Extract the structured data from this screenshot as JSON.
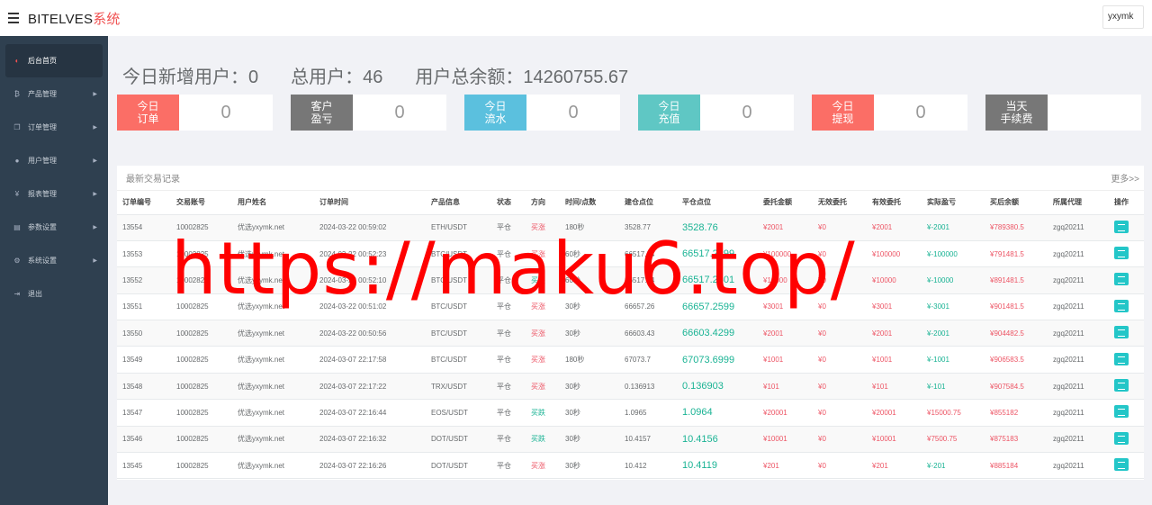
{
  "topbar": {
    "brand_main": "BITELVES",
    "brand_accent": "系统",
    "user": "yxymk"
  },
  "sidebar": {
    "items": [
      {
        "label": "后台首页",
        "icon": "dashboard-icon",
        "active": true
      },
      {
        "label": "产品管理",
        "icon": "bitcoin-icon"
      },
      {
        "label": "订单管理",
        "icon": "copy-icon"
      },
      {
        "label": "用户管理",
        "icon": "user-icon"
      },
      {
        "label": "报表管理",
        "icon": "yen-icon"
      },
      {
        "label": "参数设置",
        "icon": "files-icon"
      },
      {
        "label": "系统设置",
        "icon": "cogs-icon"
      },
      {
        "label": "退出",
        "icon": "logout-icon"
      }
    ]
  },
  "summary": {
    "new_users": "今日新增用户：0",
    "total_users": "总用户：46",
    "total_balance": "用户总余额：14260755.67"
  },
  "cards": [
    {
      "label": "今日\n订单",
      "value": "0",
      "color": "#fb6e66"
    },
    {
      "label": "客户\n盈亏",
      "value": "0",
      "color": "#777777"
    },
    {
      "label": "今日\n流水",
      "value": "0",
      "color": "#5bc0de"
    },
    {
      "label": "今日\n充值",
      "value": "0",
      "color": "#5fc7c4"
    },
    {
      "label": "今日\n提现",
      "value": "0",
      "color": "#fb6e66"
    },
    {
      "label": "当天\n手续费",
      "value": "",
      "color": "#777777"
    }
  ],
  "table": {
    "title": "最新交易记录",
    "more": "更多>>",
    "headers": [
      "订单编号",
      "交易账号",
      "用户姓名",
      "订单时间",
      "产品信息",
      "状态",
      "方向",
      "时间/点数",
      "建仓点位",
      "平仓点位",
      "委托金额",
      "无效委托",
      "有效委托",
      "实际盈亏",
      "买后余额",
      "所属代理",
      "操作"
    ],
    "rows": [
      [
        "13554",
        "10002825",
        "优选yxymk.net",
        "2024-03-22 00:59:02",
        "ETH/USDT",
        "平仓",
        "买涨",
        "180秒",
        "3528.77",
        "3528.76",
        "¥2001",
        "¥0",
        "¥2001",
        "¥-2001",
        "¥789380.5",
        "zgq20211"
      ],
      [
        "13553",
        "10002825",
        "优选yxymk.net",
        "2024-03-22 00:52:23",
        "BTC/USDT",
        "平仓",
        "买涨",
        "60秒",
        "66517.24",
        "66517.2399",
        "¥100000",
        "¥0",
        "¥100000",
        "¥-100000",
        "¥791481.5",
        "zgq20211"
      ],
      [
        "13552",
        "10002825",
        "优选yxymk.net",
        "2024-03-22 00:52:10",
        "BTC/USDT",
        "平仓",
        "买跌",
        "60秒",
        "66517.24",
        "66517.2401",
        "¥10000",
        "¥0",
        "¥10000",
        "¥-10000",
        "¥891481.5",
        "zgq20211"
      ],
      [
        "13551",
        "10002825",
        "优选yxymk.net",
        "2024-03-22 00:51:02",
        "BTC/USDT",
        "平仓",
        "买涨",
        "30秒",
        "66657.26",
        "66657.2599",
        "¥3001",
        "¥0",
        "¥3001",
        "¥-3001",
        "¥901481.5",
        "zgq20211"
      ],
      [
        "13550",
        "10002825",
        "优选yxymk.net",
        "2024-03-22 00:50:56",
        "BTC/USDT",
        "平仓",
        "买涨",
        "30秒",
        "66603.43",
        "66603.4299",
        "¥2001",
        "¥0",
        "¥2001",
        "¥-2001",
        "¥904482.5",
        "zgq20211"
      ],
      [
        "13549",
        "10002825",
        "优选yxymk.net",
        "2024-03-07 22:17:58",
        "BTC/USDT",
        "平仓",
        "买涨",
        "180秒",
        "67073.7",
        "67073.6999",
        "¥1001",
        "¥0",
        "¥1001",
        "¥-1001",
        "¥906583.5",
        "zgq20211"
      ],
      [
        "13548",
        "10002825",
        "优选yxymk.net",
        "2024-03-07 22:17:22",
        "TRX/USDT",
        "平仓",
        "买涨",
        "30秒",
        "0.136913",
        "0.136903",
        "¥101",
        "¥0",
        "¥101",
        "¥-101",
        "¥907584.5",
        "zgq20211"
      ],
      [
        "13547",
        "10002825",
        "优选yxymk.net",
        "2024-03-07 22:16:44",
        "EOS/USDT",
        "平仓",
        "买跌",
        "30秒",
        "1.0965",
        "1.0964",
        "¥20001",
        "¥0",
        "¥20001",
        "¥15000.75",
        "¥855182",
        "zgq20211"
      ],
      [
        "13546",
        "10002825",
        "优选yxymk.net",
        "2024-03-07 22:16:32",
        "DOT/USDT",
        "平仓",
        "买跌",
        "30秒",
        "10.4157",
        "10.4156",
        "¥10001",
        "¥0",
        "¥10001",
        "¥7500.75",
        "¥875183",
        "zgq20211"
      ],
      [
        "13545",
        "10002825",
        "优选yxymk.net",
        "2024-03-07 22:16:26",
        "DOT/USDT",
        "平仓",
        "买涨",
        "30秒",
        "10.412",
        "10.4119",
        "¥201",
        "¥0",
        "¥201",
        "¥-201",
        "¥885184",
        "zgq20211"
      ]
    ]
  },
  "watermark": "https://maku6.top/"
}
